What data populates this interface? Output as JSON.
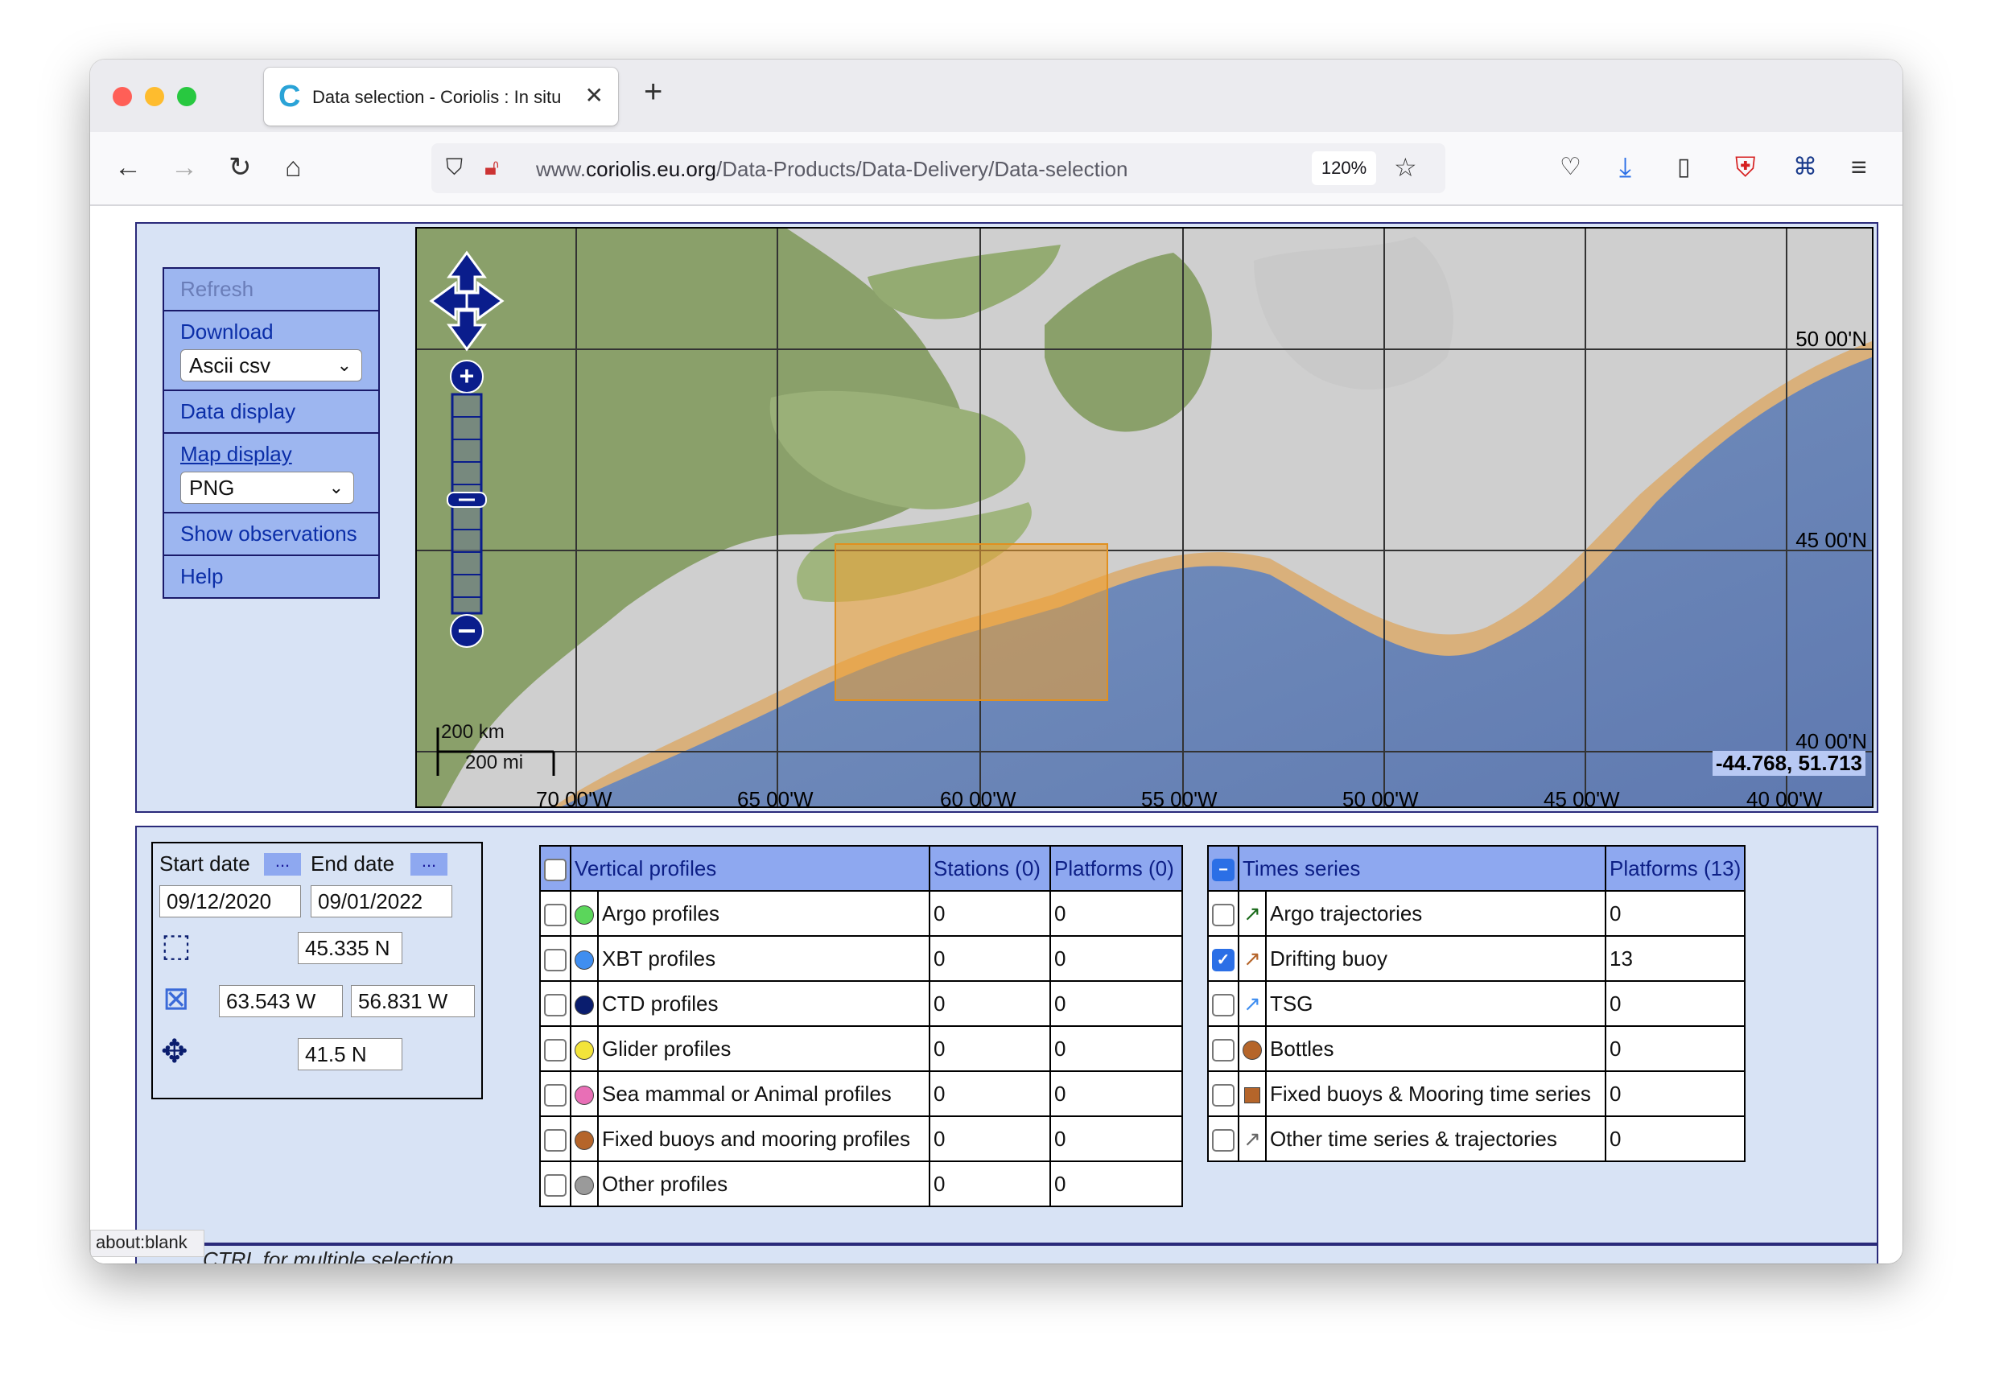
{
  "browser": {
    "tab_title": "Data selection - Coriolis : In situ",
    "url_prefix": "www.",
    "url_domain": "coriolis.eu.org",
    "url_path": "/Data-Products/Data-Delivery/Data-selection",
    "zoom": "120%",
    "status_bar": "about:blank"
  },
  "menu": {
    "refresh": "Refresh",
    "download": "Download",
    "download_format": "Ascii csv",
    "data_display": "Data display",
    "map_display": "Map display",
    "map_format": "PNG",
    "show_observations": "Show observations",
    "help": "Help"
  },
  "map": {
    "lon_labels": [
      "70 00'W",
      "65 00'W",
      "60 00'W",
      "55 00'W",
      "50 00'W",
      "45 00'W",
      "40 00'W"
    ],
    "lat_labels": [
      "50 00'N",
      "45 00'N",
      "40 00'N"
    ],
    "scale_km": "200 km",
    "scale_mi": "200 mi",
    "cursor_coords": "-44.768, 51.713"
  },
  "dates": {
    "start_label": "Start date",
    "end_label": "End date",
    "ellipsis": "...",
    "start_value": "09/12/2020",
    "end_value": "09/01/2022",
    "north": "45.335 N",
    "west": "63.543 W",
    "east": "56.831 W",
    "south": "41.5 N"
  },
  "vertical_profiles": {
    "header": "Vertical profiles",
    "stations_header": "Stations (0)",
    "platforms_header": "Platforms (0)",
    "rows": [
      {
        "name": "Argo profiles",
        "color": "#5bd65b",
        "stations": "0",
        "platforms": "0"
      },
      {
        "name": "XBT profiles",
        "color": "#3f8ef0",
        "stations": "0",
        "platforms": "0"
      },
      {
        "name": "CTD profiles",
        "color": "#0a1d6e",
        "stations": "0",
        "platforms": "0"
      },
      {
        "name": "Glider profiles",
        "color": "#f3e43a",
        "stations": "0",
        "platforms": "0"
      },
      {
        "name": "Sea mammal or Animal profiles",
        "color": "#e86fb6",
        "stations": "0",
        "platforms": "0"
      },
      {
        "name": "Fixed buoys and mooring profiles",
        "color": "#b5652a",
        "stations": "0",
        "platforms": "0"
      },
      {
        "name": "Other profiles",
        "color": "#9a9a9a",
        "stations": "0",
        "platforms": "0"
      }
    ]
  },
  "time_series": {
    "header": "Times series",
    "platforms_header": "Platforms (13)",
    "rows": [
      {
        "name": "Argo trajectories",
        "platforms": "0",
        "checked": false,
        "icon": "argo-trajectory-icon"
      },
      {
        "name": "Drifting buoy",
        "platforms": "13",
        "checked": true,
        "icon": "drifting-buoy-icon"
      },
      {
        "name": "TSG",
        "platforms": "0",
        "checked": false,
        "icon": "tsg-icon"
      },
      {
        "name": "Bottles",
        "platforms": "0",
        "checked": false,
        "icon": "bottle-icon"
      },
      {
        "name": "Fixed buoys & Mooring time series",
        "platforms": "0",
        "checked": false,
        "icon": "mooring-icon"
      },
      {
        "name": "Other time series & trajectories",
        "platforms": "0",
        "checked": false,
        "icon": "other-trajectory-icon"
      }
    ]
  },
  "footer_hint": "CTRL for multiple selection"
}
